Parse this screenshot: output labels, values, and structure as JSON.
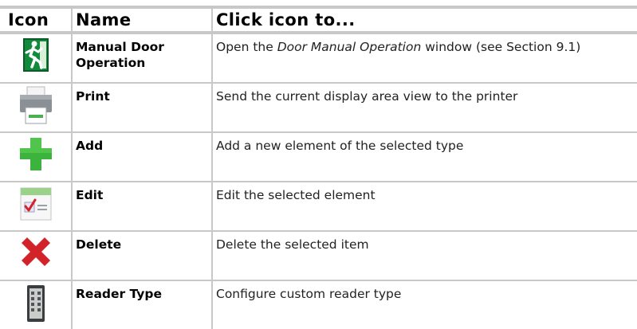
{
  "header": {
    "icon": "Icon",
    "name": "Name",
    "click": "Click icon to..."
  },
  "rows": [
    {
      "icon": "running-man-exit-icon",
      "name": "Manual Door Operation",
      "desc_before": "Open the ",
      "desc_italic": "Door Manual Operation",
      "desc_after": " window (see Section 9.1)"
    },
    {
      "icon": "printer-icon",
      "name": "Print",
      "desc": "Send the current display area view to the printer"
    },
    {
      "icon": "green-plus-icon",
      "name": "Add",
      "desc": "Add a new element of the selected type"
    },
    {
      "icon": "edit-form-icon",
      "name": "Edit",
      "desc": "Edit the selected element"
    },
    {
      "icon": "red-x-icon",
      "name": "Delete",
      "desc": "Delete the selected item"
    },
    {
      "icon": "card-reader-icon",
      "name": "Reader Type",
      "desc": "Configure custom reader type"
    }
  ],
  "colors": {
    "grid": "#c8c8c8",
    "add_green": "#3cb33c",
    "delete_red": "#d2232a"
  }
}
